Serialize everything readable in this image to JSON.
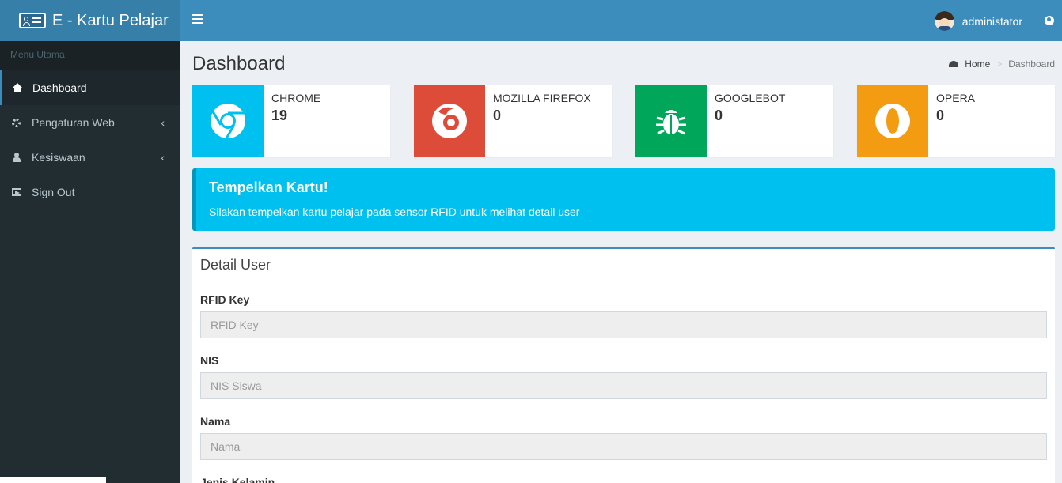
{
  "app": {
    "title": "E - Kartu Pelajar"
  },
  "header": {
    "user_name": "administator"
  },
  "sidebar": {
    "menu_header": "Menu Utama",
    "items": [
      {
        "label": "Dashboard",
        "icon": "home-icon",
        "active": true
      },
      {
        "label": "Pengaturan Web",
        "icon": "gear-icon",
        "chevron": "‹"
      },
      {
        "label": "Kesiswaan",
        "icon": "user-icon",
        "chevron": "‹"
      },
      {
        "label": "Sign Out",
        "icon": "sign-out-icon"
      }
    ]
  },
  "page": {
    "title": "Dashboard"
  },
  "breadcrumb": {
    "home": "Home",
    "separator": ">",
    "current": "Dashboard"
  },
  "stats": [
    {
      "label": "CHROME",
      "value": "19",
      "color": "#00c0ef",
      "icon": "chrome-icon"
    },
    {
      "label": "MOZILLA FIREFOX",
      "value": "0",
      "color": "#dd4b39",
      "icon": "firefox-icon"
    },
    {
      "label": "GOOGLEBOT",
      "value": "0",
      "color": "#00a65a",
      "icon": "bug-icon"
    },
    {
      "label": "OPERA",
      "value": "0",
      "color": "#f39c12",
      "icon": "opera-icon"
    }
  ],
  "alert": {
    "title": "Tempelkan Kartu!",
    "message": "Silakan tempelkan kartu pelajar pada sensor RFID untuk melihat detail user"
  },
  "detail": {
    "title": "Detail User",
    "fields": [
      {
        "label": "RFID Key",
        "placeholder": "RFID Key"
      },
      {
        "label": "NIS",
        "placeholder": "NIS Siswa"
      },
      {
        "label": "Nama",
        "placeholder": "Nama"
      },
      {
        "label": "Jenis Kelamin"
      }
    ]
  }
}
